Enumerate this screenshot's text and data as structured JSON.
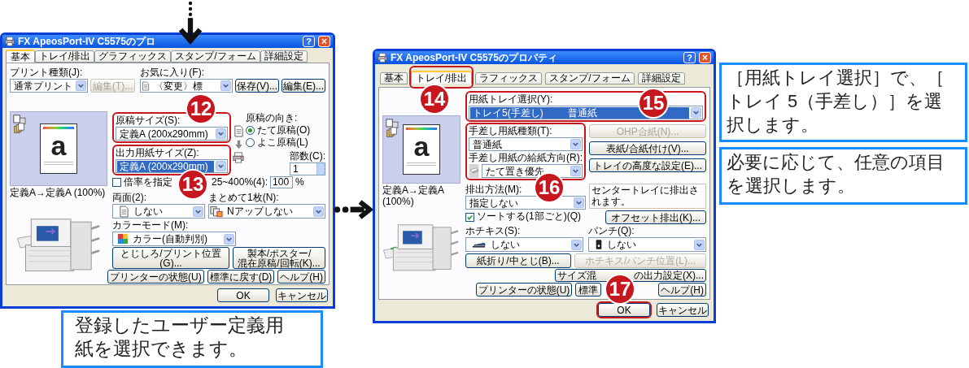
{
  "dialogs": [
    {
      "kind": "basic",
      "title": "FX ApeosPort-IV C5575のプロ",
      "help_button": "?",
      "close_button": "×",
      "tabs": [
        {
          "label": "基本",
          "selected": true
        },
        {
          "label": "トレイ/排出",
          "selected": false
        },
        {
          "label": "グラフィックス",
          "selected": false
        },
        {
          "label": "スタンプ/フォーム",
          "selected": false
        },
        {
          "label": "詳細設定",
          "selected": false
        }
      ],
      "print_type": {
        "label": "プリント種類(J):",
        "value": "通常プリント"
      },
      "print_type_edit": {
        "label": "編集(T)...",
        "disabled": true
      },
      "favorites": {
        "label": "お気に入り(F):",
        "value": "〈変更〉標"
      },
      "favorite_buttons": [
        {
          "label": "保存(V)...",
          "disabled": false
        },
        {
          "label": "編集(E)...",
          "disabled": false
        }
      ],
      "preview": {
        "letter": "a",
        "caption": "定義A→定義A (100%)"
      },
      "size_fields": [
        {
          "label": "原稿サイズ(S):",
          "value": "定義A (200x290mm)",
          "highlighted": false,
          "annotated": true,
          "badge": "12"
        },
        {
          "label": "出力用紙サイズ(Z):",
          "value": "定義A (200x290mm)",
          "highlighted": true,
          "annotated": true,
          "badge": "13"
        }
      ],
      "orientation": {
        "label": "原稿の向き:",
        "options": [
          {
            "label": "たて原稿(O)",
            "selected": true
          },
          {
            "label": "よこ原稿(L)",
            "selected": false
          }
        ]
      },
      "copies": {
        "label": "部数(C):",
        "value": "1"
      },
      "scale": {
        "label": "倍率を指定",
        "checked": false,
        "range_label": "25~400%(4):",
        "value": "100",
        "unit": "%"
      },
      "duplex": {
        "label": "両面(2):",
        "value": "しない"
      },
      "nup": {
        "label": "まとめて1枚(N):",
        "value": "Nアップしない"
      },
      "color_mode": {
        "label": "カラーモード(M):",
        "value": "カラー(自動判別)"
      },
      "option_buttons": [
        {
          "label": "とじしろ/プリント位置(G)...",
          "disabled": false
        },
        {
          "label": "製本/ポスター/\n混在原稿/回転(K)...",
          "disabled": false
        }
      ],
      "footer_buttons": [
        {
          "label": "プリンターの状態(U)",
          "disabled": false
        },
        {
          "label": "標準に戻す(D)",
          "disabled": false
        },
        {
          "label": "ヘルプ(H)",
          "disabled": false
        }
      ],
      "dialog_buttons": [
        {
          "label": "OK",
          "annotated": false
        },
        {
          "label": "キャンセル",
          "annotated": false
        }
      ]
    },
    {
      "kind": "tray",
      "title": "FX ApeosPort-IV C5575のプロパティ",
      "help_button": "?",
      "close_button": "×",
      "tabs": [
        {
          "label": "基本",
          "selected": false,
          "annotated": false
        },
        {
          "label": "トレイ/排出",
          "selected": true,
          "annotated": true,
          "badge": "14"
        },
        {
          "label": "ラフィックス",
          "selected": false,
          "annotated": false
        },
        {
          "label": "スタンプ/フォーム",
          "selected": false,
          "annotated": false
        },
        {
          "label": "詳細設定",
          "selected": false,
          "annotated": false
        }
      ],
      "preview": {
        "letter": "a",
        "caption": "定義A→定義A (100%)"
      },
      "paper_tray": {
        "label": "用紙トレイ選択(Y):",
        "value": "トレイ5(手差し)",
        "value_2": "普通紙",
        "highlighted": true,
        "annotated": true,
        "badge": "15"
      },
      "manual_feed": {
        "annotated": true,
        "badge": "16",
        "paper_type": {
          "label": "手差し用紙種類(T):",
          "value": "普通紙"
        },
        "direction": {
          "label": "手差し用紙の給紙方向(R):",
          "value": "たて置き優先"
        }
      },
      "tray_buttons": [
        {
          "label": "OHP合紙(N)...",
          "disabled": true
        },
        {
          "label": "表紙/合紙付け(V)...",
          "disabled": false
        },
        {
          "label": "トレイの高度な設定(E)...",
          "disabled": false
        }
      ],
      "output": {
        "label": "排出方法(M):",
        "value": "指定しない"
      },
      "output_info": "センタートレイに排出されます。",
      "sort": {
        "label": "ソートする(1部ごと)(Q)",
        "checked": true
      },
      "offset_button": {
        "label": "オフセット排出(K)...",
        "disabled": false
      },
      "staple": {
        "label": "ホチキス(S):",
        "value": "しない"
      },
      "punch": {
        "label": "パンチ(Q):",
        "value": "しない"
      },
      "finish_buttons": [
        {
          "label": "紙折り/中とじ(B)...",
          "disabled": false
        },
        {
          "label": "ホチキス/パンチ位置(L)...",
          "disabled": true
        }
      ],
      "mixed_size_button": {
        "label_start": "サイズ混",
        "label_end": "の出力設定(X)...",
        "disabled": false
      },
      "footer_buttons": [
        {
          "label": "プリンターの状態(U)",
          "disabled": false
        },
        {
          "label": "標準",
          "disabled": false
        },
        {
          "label": "ヘルプ(H)",
          "disabled": false
        }
      ],
      "dialog_buttons": [
        {
          "label": "OK",
          "annotated": true,
          "badge": "17"
        },
        {
          "label": "キャンセル",
          "annotated": false
        }
      ]
    }
  ],
  "callouts": [
    {
      "text": "［用紙トレイ選択］で、［トレイ 5（手差し）］を選択します。"
    },
    {
      "text": "必要に応じて、任意の項目を選択します。"
    },
    {
      "text": "登録したユーザー定義用紙を選択できます。"
    }
  ]
}
